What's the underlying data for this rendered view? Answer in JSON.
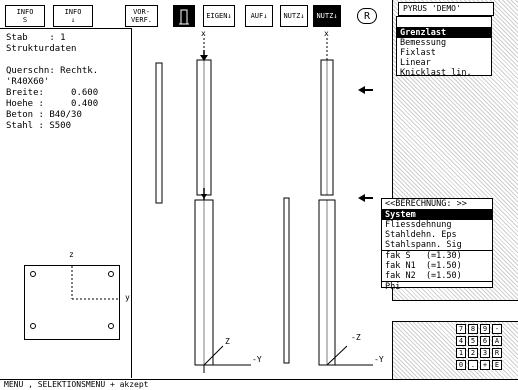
{
  "toolbar": {
    "info_s": [
      "INFO",
      "S"
    ],
    "info_arrow": [
      "INFO",
      "↓"
    ],
    "vorverf": [
      "VOR-",
      "VERF."
    ],
    "eigen": "EIGEN↓",
    "auf": "AUF↓",
    "nutz1": "NUTZ↓",
    "nutz2": "NUTZ↓",
    "r_button": "R"
  },
  "left_panel": {
    "lines": [
      "Stab    : 1",
      "Strukturdaten",
      "",
      "Querschn: Rechtk.",
      "'R40X60'",
      "Breite:     0.600",
      "Hoehe :     0.400",
      "Beton : B40/30",
      "Stahl : S500"
    ]
  },
  "pyrus_label": "PYRUS 'DEMO'",
  "menu_berechnung": {
    "header": "BERECHNUNG",
    "items": [
      "Grenzlast",
      "Bemessung",
      "Fixlast",
      "Linear",
      "Knicklast lin."
    ],
    "selected_index": 0
  },
  "menu_berechnung2": {
    "header": "<<BERECHNUNG: >>",
    "items": [
      "System",
      "Fliessdehnung",
      "Stahldehn. Eps",
      "Stahlspann. Sig",
      "fak S   (=1.30)",
      "fak N1  (=1.50)",
      "fak N2  (=1.50)",
      "Phi"
    ],
    "selected_index": 0
  },
  "structure_labels": {
    "top1": "x",
    "top2": "x",
    "axis_z1": "Z",
    "axis_y1": "-Y",
    "axis_z2": "-Z",
    "axis_y2": "-Y",
    "section_z": "z",
    "section_y": "y"
  },
  "keypad": {
    "rows": [
      [
        "7",
        "8",
        "9",
        "-"
      ],
      [
        "4",
        "5",
        "6",
        "A"
      ],
      [
        "1",
        "2",
        "3",
        "R"
      ],
      [
        "0",
        ".",
        "+",
        "E"
      ]
    ]
  },
  "status_bar": "MENU , SELEKTIONSMENU + akzept"
}
